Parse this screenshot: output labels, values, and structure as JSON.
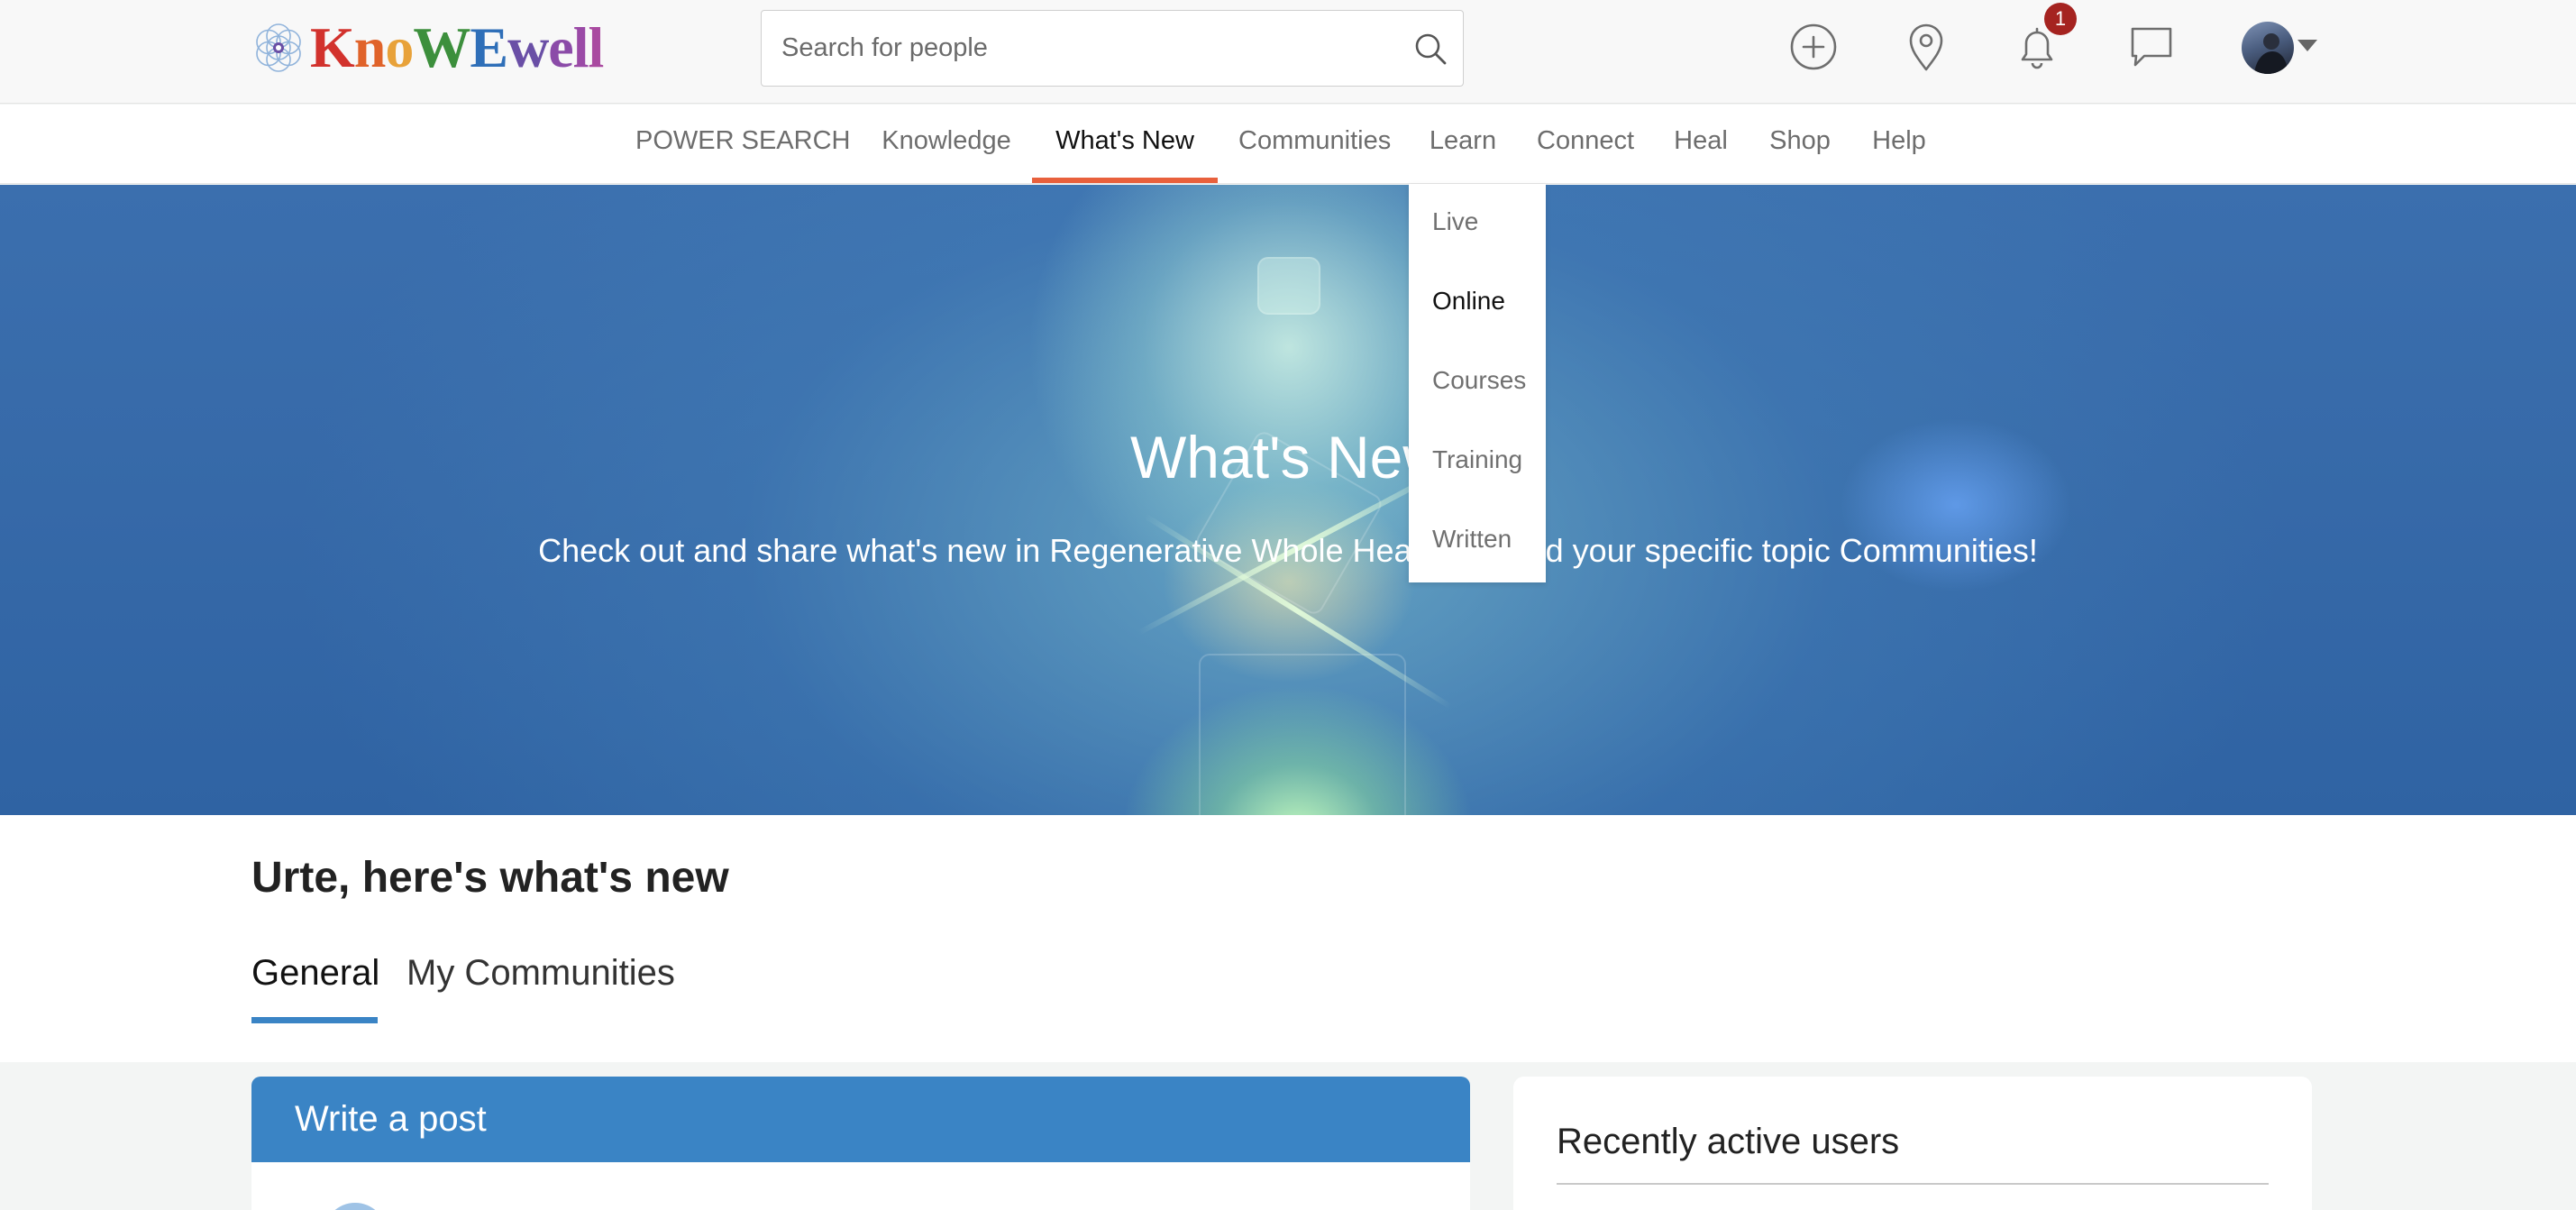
{
  "brand": {
    "logo_text": "KnoWEwell",
    "letters": [
      {
        "ch": "K",
        "color": "#d2322d"
      },
      {
        "ch": "n",
        "color": "#e0632a"
      },
      {
        "ch": "o",
        "color": "#e8a23a"
      },
      {
        "ch": "W",
        "color": "#3c8f3c"
      },
      {
        "ch": "E",
        "color": "#2f6fb8"
      },
      {
        "ch": "w",
        "color": "#6a4fa6"
      },
      {
        "ch": "e",
        "color": "#8b4ba8"
      },
      {
        "ch": "l",
        "color": "#9a4aa6"
      },
      {
        "ch": "l",
        "color": "#a94aa0"
      }
    ]
  },
  "header": {
    "search": {
      "placeholder": "Search for people",
      "icon": "search-icon"
    },
    "icons": [
      {
        "name": "add-icon"
      },
      {
        "name": "location-pin-icon"
      },
      {
        "name": "bell-icon"
      },
      {
        "name": "chat-icon"
      }
    ],
    "notification_count": "1",
    "avatar": "user-avatar"
  },
  "nav": {
    "items": [
      {
        "label": "POWER SEARCH"
      },
      {
        "label": "Knowledge"
      },
      {
        "label": "What's New",
        "active": true
      },
      {
        "label": "Communities"
      },
      {
        "label": "Learn"
      },
      {
        "label": "Connect"
      },
      {
        "label": "Heal"
      },
      {
        "label": "Shop"
      },
      {
        "label": "Help"
      }
    ],
    "active_color": "#e8603c"
  },
  "learn_menu": {
    "items": [
      {
        "label": "Live"
      },
      {
        "label": "Online",
        "active": true
      },
      {
        "label": "Courses"
      },
      {
        "label": "Training"
      },
      {
        "label": "Written"
      }
    ]
  },
  "hero": {
    "title": "What's New",
    "subtitle": "Check out and share what's new in Regenerative Whole Health 2.0 and your specific topic Communities!"
  },
  "feed": {
    "greeting": "Urte, here's what's new",
    "tabs": [
      {
        "label": "General",
        "active": true
      },
      {
        "label": "My Communities"
      }
    ],
    "accent": "#3a84c5"
  },
  "write_post": {
    "title": "Write a post"
  },
  "recent_users": {
    "title": "Recently active users"
  }
}
